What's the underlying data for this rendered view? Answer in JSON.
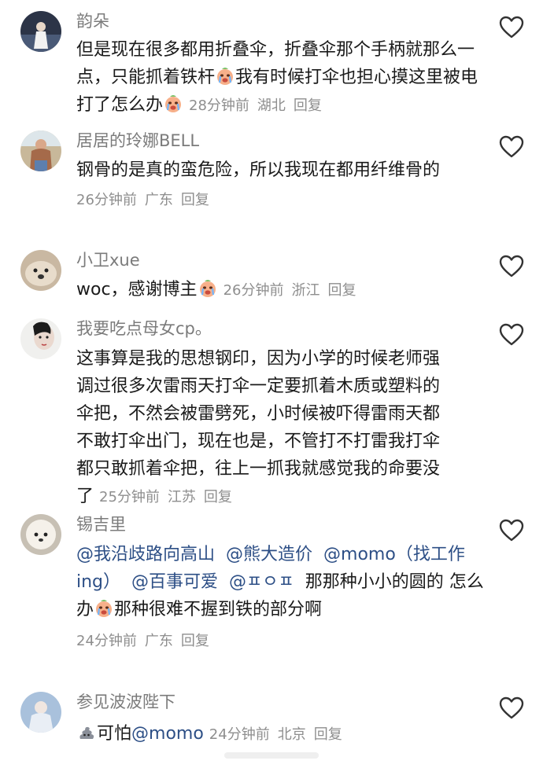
{
  "comments": [
    {
      "username": "韵朵",
      "text_parts": [
        "但是现在很多都用折叠伞，折叠伞那个手柄就那么一点，只能抓着铁杆",
        "我有时候打伞也担心摸这里被电打了怎么办"
      ],
      "time": "28分钟前",
      "location": "湖北",
      "reply": "回复"
    },
    {
      "username": "居居的玲娜BELL",
      "text": "钢骨的是真的蛮危险，所以我现在都用纤维骨的",
      "time": "26分钟前",
      "location": "广东",
      "reply": "回复"
    },
    {
      "username": "小卫xue",
      "text": "woc，感谢博主",
      "time": "26分钟前",
      "location": "浙江",
      "reply": "回复"
    },
    {
      "username": "我要吃点母女cp。",
      "text_lines": [
        "这事算是我的思想钢印，因为小学的时候老师强",
        "调过很多次雷雨天打伞一定要抓着木质或塑料的",
        "伞把，不然会被雷劈死，小时候被吓得雷雨天都",
        "不敢打伞出门，现在也是，不管打不打雷我打伞",
        "都只敢抓着伞把，往上一抓我就感觉我的命要没",
        "了"
      ],
      "time": "25分钟前",
      "location": "江苏",
      "reply": "回复"
    },
    {
      "username": "锡吉里",
      "mentions": [
        "@我沿歧路向高山",
        "@熊大造价",
        "@momo（找工作ing）",
        "@百事可爱",
        "@ㅍㅇㅍ"
      ],
      "text_a": "那那种小小的圆的",
      "text_b": "怎么办",
      "text_c": "那种很难不握到铁的部分啊",
      "time": "24分钟前",
      "location": "广东",
      "reply": "回复"
    },
    {
      "username": "参见波波陛下",
      "text": "可怕",
      "mention": "@momo",
      "time": "24分钟前",
      "location": "北京",
      "reply": "回复"
    }
  ],
  "icons": {
    "like": "heart-outline-icon",
    "cry_emoji": "crying-face-emoji",
    "poop_emoji": "poop-emoji"
  },
  "colors": {
    "username": "#7b7b7b",
    "meta": "#8e8e8e",
    "mention": "#2d4f86",
    "text": "#1a1a1a"
  }
}
